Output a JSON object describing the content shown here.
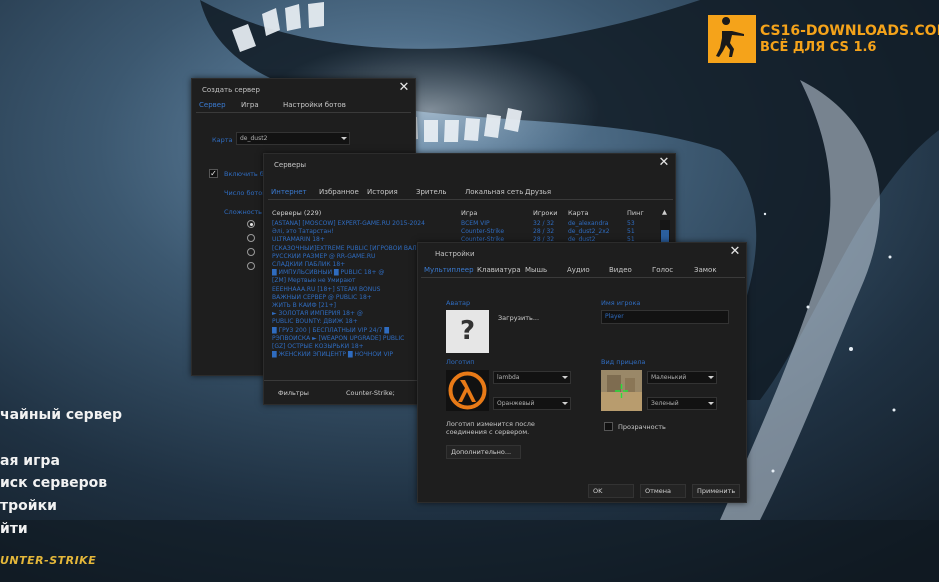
{
  "watermark": {
    "line1": "CS16-DOWNLOADS.COM",
    "line2": "ВСЁ ДЛЯ CS 1.6"
  },
  "main_menu": {
    "items": [
      "чайный сервер",
      "ая игра",
      "иск серверов",
      "тройки",
      "йти"
    ],
    "logo_text": "UNTER-STRIKE"
  },
  "create_server": {
    "title": "Создать сервер",
    "tabs": [
      "Сервер",
      "Игра",
      "Настройки ботов"
    ],
    "map_label": "Карта",
    "map_value": "de_dust2",
    "enable_bots_label": "Включить бо",
    "bot_count_label": "Число ботов",
    "difficulty_label": "Сложность"
  },
  "servers": {
    "title": "Серверы",
    "tabs": [
      "Интернет",
      "Избранное",
      "История",
      "Зритель",
      "Локальная сеть",
      "Друзья"
    ],
    "headers": {
      "name": "Серверы (229)",
      "game": "Игра",
      "players": "Игроки",
      "map": "Карта",
      "ping": "Пинг"
    },
    "rows": [
      {
        "name": "[ASTANA] [MOSCOW] EXPERT-GAME.RU 2015-2024",
        "game": "ВСЕМ VIP",
        "players": "32 / 32",
        "map": "de_alexandra",
        "ping": "53"
      },
      {
        "name": "Әлі, это Татарстан!",
        "game": "Counter-Strike",
        "players": "28 / 32",
        "map": "de_dust2_2x2",
        "ping": "51"
      },
      {
        "name": "ULTRAMARIN 18+",
        "game": "Counter-Strike",
        "players": "28 / 32",
        "map": "de_dust2",
        "ping": "51"
      },
      {
        "name": "[СКАЗОЧНЫЙ]EXTREME PUBLIC [ИГРОВОЙ ВАЛ",
        "game": "",
        "players": "",
        "map": "",
        "ping": ""
      },
      {
        "name": "РУССКИЙ РАЗМЕР @ RR-GAME.RU",
        "game": "",
        "players": "",
        "map": "",
        "ping": ""
      },
      {
        "name": "СЛАДКИЙ ПАБЛИК 18+",
        "game": "",
        "players": "",
        "map": "",
        "ping": ""
      },
      {
        "name": "█ ИМПУЛЬСИВНЫЙ █ PUBLIC 18+ @",
        "game": "",
        "players": "",
        "map": "",
        "ping": ""
      },
      {
        "name": "[ZM] Мертвые не Умирают",
        "game": "",
        "players": "",
        "map": "",
        "ping": ""
      },
      {
        "name": "EEEHHAAA.RU [18+] STEAM BONUS",
        "game": "",
        "players": "",
        "map": "",
        "ping": ""
      },
      {
        "name": "ВАЖНЫЙ СЕРВЕР @ PUBLIC 18+",
        "game": "",
        "players": "",
        "map": "",
        "ping": ""
      },
      {
        "name": "ЖИТЬ В КАЙФ [21+]",
        "game": "",
        "players": "",
        "map": "",
        "ping": ""
      },
      {
        "name": "► ЗОЛОТАЯ ИМПЕРИЯ 18+ @",
        "game": "",
        "players": "",
        "map": "",
        "ping": ""
      },
      {
        "name": "PUBLIC BOUNTY: ДВИЖ 18+",
        "game": "",
        "players": "",
        "map": "",
        "ping": ""
      },
      {
        "name": "█ ГРУЗ 200 | БЕСПЛАТНЫЙ VIP 24/7 █",
        "game": "",
        "players": "",
        "map": "",
        "ping": ""
      },
      {
        "name": "РЭПВОЙСКА ► [WEAPON UPGRADE] PUBLIC",
        "game": "",
        "players": "",
        "map": "",
        "ping": ""
      },
      {
        "name": "[GZ] ОСТРЫЕ КОЗЫРЬКИ 18+",
        "game": "",
        "players": "",
        "map": "",
        "ping": ""
      },
      {
        "name": "█ ЖЕНСКИЙ ЭПИЦЕНТР █ НОЧНОЙ VIP",
        "game": "",
        "players": "",
        "map": "",
        "ping": ""
      }
    ],
    "filters_label": "Фильтры",
    "filter_game": "Counter-Strike;"
  },
  "settings": {
    "title": "Настройки",
    "tabs": [
      "Мультиплеер",
      "Клавиатура",
      "Мышь",
      "Аудио",
      "Видео",
      "Голос",
      "Замок"
    ],
    "avatar_label": "Аватар",
    "upload_button": "Загрузить...",
    "player_name_label": "Имя игрока",
    "player_name_value": "Player",
    "logo_label": "Логотип",
    "logo_combo": "lambda",
    "logo_color": "Оранжевый",
    "logo_note": "Логотип изменится после соединения с сервером.",
    "crosshair_label": "Вид прицела",
    "crosshair_size": "Маленький",
    "crosshair_color": "Зеленый",
    "transparency_label": "Прозрачность",
    "advanced_button": "Дополнительно...",
    "ok_button": "OK",
    "cancel_button": "Отмена",
    "apply_button": "Применить"
  },
  "colors": {
    "accent": "#2f6cc0",
    "watermark": "#f5a31a"
  }
}
